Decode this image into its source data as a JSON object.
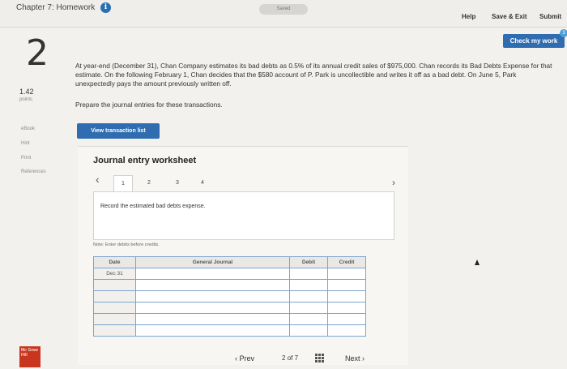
{
  "header": {
    "chapter_title": "Chapter 7: Homework",
    "saved_status": "Saved",
    "help_label": "Help",
    "save_exit_label": "Save & Exit",
    "submit_label": "Submit",
    "check_work_label": "Check my work",
    "check_badge": "3"
  },
  "question": {
    "number": "2",
    "points_value": "1.42",
    "points_label": "points",
    "text": "At year-end (December 31), Chan Company estimates its bad debts as 0.5% of its annual credit sales of $975,000. Chan records its Bad Debts Expense for that estimate. On the following February 1, Chan decides that the $580 account of P. Park is uncollectible and writes it off as a bad debt. On June 5, Park unexpectedly pays the amount previously written off.",
    "instruction": "Prepare the journal entries for these transactions."
  },
  "sidebar": {
    "links": [
      "eBook",
      "Hint",
      "Print",
      "References"
    ]
  },
  "worksheet": {
    "view_list_label": "View transaction list",
    "title": "Journal entry worksheet",
    "steps": [
      "1",
      "2",
      "3",
      "4"
    ],
    "active_step": 1,
    "record_text": "Record the estimated bad debts expense.",
    "note": "Note: Enter debits before credits.",
    "table": {
      "headers": [
        "Date",
        "General Journal",
        "Debit",
        "Credit"
      ],
      "rows": [
        [
          "Dec 31",
          "",
          "",
          ""
        ],
        [
          "",
          "",
          "",
          ""
        ],
        [
          "",
          "",
          "",
          ""
        ],
        [
          "",
          "",
          "",
          ""
        ],
        [
          "",
          "",
          "",
          ""
        ],
        [
          "",
          "",
          "",
          ""
        ]
      ]
    }
  },
  "footer": {
    "logo_text": "Mc Graw Hill",
    "prev_label": "Prev",
    "page_current": "2",
    "page_of": "of",
    "page_total": "7",
    "next_label": "Next"
  },
  "colors": {
    "primary_button": "#2f6db0",
    "logo_red": "#c8361f",
    "table_border": "#7aa4cf"
  }
}
